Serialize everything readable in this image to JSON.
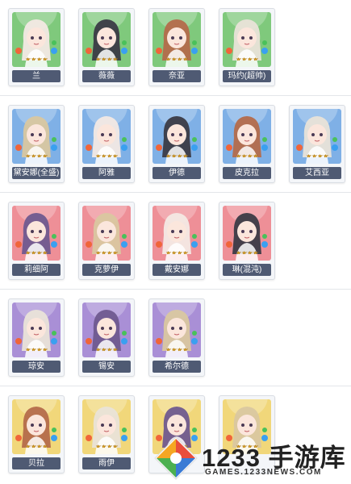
{
  "rows": [
    {
      "bg": "green",
      "cards": [
        {
          "name": "兰"
        },
        {
          "name": "薇薇"
        },
        {
          "name": "奈亚"
        },
        {
          "name": "玛约(超帅)"
        }
      ]
    },
    {
      "bg": "blue",
      "cards": [
        {
          "name": "黛安娜(全盛)"
        },
        {
          "name": "阿雅"
        },
        {
          "name": "伊德"
        },
        {
          "name": "皮克拉"
        },
        {
          "name": "艾西亚"
        }
      ]
    },
    {
      "bg": "red",
      "cards": [
        {
          "name": "莉细阿"
        },
        {
          "name": "克萝伊"
        },
        {
          "name": "戴安娜"
        },
        {
          "name": "琳(混沌)"
        }
      ]
    },
    {
      "bg": "purple",
      "cards": [
        {
          "name": "琼安"
        },
        {
          "name": "锡安"
        },
        {
          "name": "希尔德"
        }
      ]
    },
    {
      "bg": "yellow",
      "cards": [
        {
          "name": "贝拉"
        },
        {
          "name": "雨伊"
        },
        {
          "name": ""
        },
        {
          "name": ""
        }
      ]
    }
  ],
  "colors": {
    "green": "#7fc97c",
    "blue": "#7fb0e6",
    "red": "#ee8f97",
    "purple": "#a98fd6",
    "yellow": "#f1d77a",
    "name_bar": "#4f5a73"
  },
  "watermark": {
    "brand": "1233 手游库",
    "url": "GAMES.1233NEWS.COM"
  }
}
